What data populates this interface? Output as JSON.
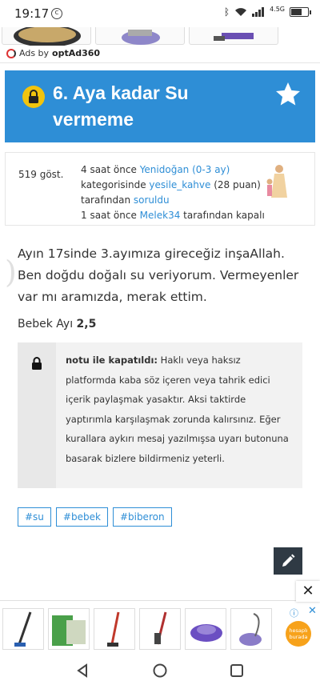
{
  "status_bar": {
    "time": "19:17",
    "network": "4.5G"
  },
  "top_ad": {
    "ads_by_prefix": "Ads by ",
    "ads_by_brand": "optAd360"
  },
  "question": {
    "title": "6. Aya kadar Su vermeme",
    "views": "519 göst.",
    "meta": {
      "asked_time": "4 saat önce",
      "category": "Yenidoğan (0-3 ay)",
      "category_suffix": " kategorisinde ",
      "user": "yesile_kahve",
      "user_points": " (28 puan) tarafından ",
      "asked_label": "soruldu",
      "closed_time": "1 saat önce ",
      "closer": "Melek34",
      "closed_suffix": " tarafından kapalı"
    },
    "body": "Ayın 17sinde 3.ayımıza gireceğiz inşaAllah. Ben doğdu doğalı su veriyorum. Vermeyenler var mı aramızda, merak ettim.",
    "category_line_label": "Bebek Ayı ",
    "category_line_value": "2,5"
  },
  "closed_note": {
    "heading": "notu ile kapatıldı:",
    "text": " Haklı veya haksız platformda kaba söz içeren veya tahrik edici içerik paylaşmak yasaktır. Aksi taktirde yaptırımla karşılaşmak zorunda kalırsınız. Eğer kurallara aykırı mesaj yazılmışsa uyarı butonuna basarak bizlere bildirmeniz yeterli."
  },
  "tags": [
    "#su",
    "#bebek",
    "#biberon"
  ],
  "bottom_ad": {
    "close": "✕",
    "info": "ⓘ",
    "x": "✕",
    "brand": "hesaplı burada"
  },
  "colors": {
    "accent": "#2e8ed6",
    "lock_yellow": "#f2c40d",
    "edit_button": "#2f3a44"
  }
}
